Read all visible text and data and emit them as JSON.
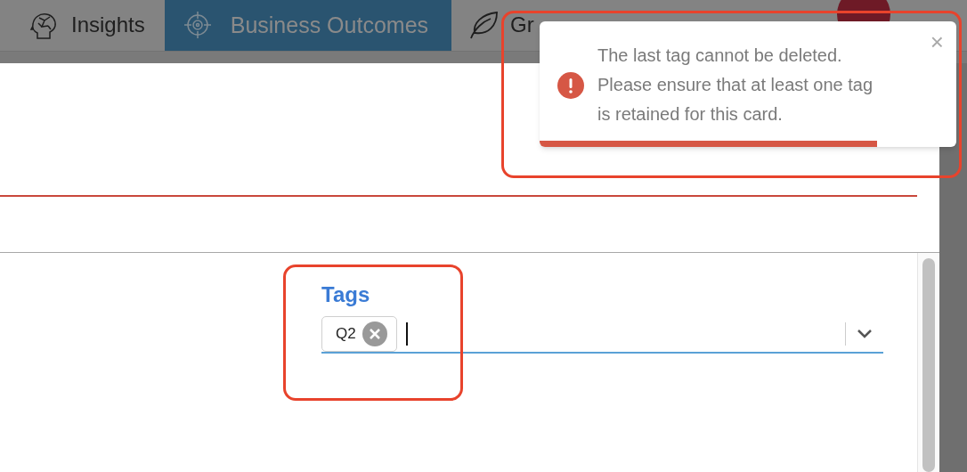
{
  "nav": {
    "tabs": [
      {
        "label": "Insights",
        "selected": false,
        "kind": "brain"
      },
      {
        "label": "Business Outcomes",
        "selected": true,
        "kind": "target"
      },
      {
        "label": "Gr",
        "selected": false,
        "kind": "leaf"
      }
    ]
  },
  "toast": {
    "kind": "error",
    "message_lines": [
      "The last tag cannot be deleted.",
      "Please ensure that at least one tag",
      "is retained for this card."
    ],
    "close": "×",
    "level": 0.81
  },
  "tags_field": {
    "label": "Tags",
    "tags": [
      {
        "label": "Q2"
      }
    ]
  }
}
